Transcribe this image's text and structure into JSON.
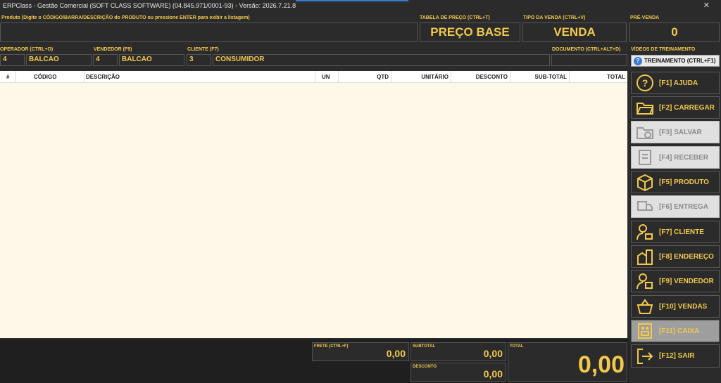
{
  "window": {
    "title": "ERPClass - Gestão Comercial (SOFT CLASS SOFTWARE) (04.845.971/0001-93) - Versão: 2026.7.21.8"
  },
  "product": {
    "label": "Produto (Digite o CÓDIGO/BARRA/DESCRIÇÃO do PRODUTO ou pressione ENTER para exibir a listagem)",
    "value": ""
  },
  "price_table": {
    "label": "TABELA DE PREÇO (CTRL+T)",
    "value": "PREÇO BASE"
  },
  "sale_type": {
    "label": "TIPO DA VENDA (CTRL+V)",
    "value": "VENDA"
  },
  "pre_sale": {
    "label": "PRÉ-VENDA",
    "value": "0"
  },
  "operator": {
    "label": "OPERADOR (CTRL+O)",
    "code": "4",
    "name": "BALCAO"
  },
  "seller": {
    "label": "VENDEDOR (F9)",
    "code": "4",
    "name": "BALCAO"
  },
  "client": {
    "label": "CLIENTE (F7)",
    "code": "3",
    "name": "CONSUMIDOR"
  },
  "document": {
    "label": "DOCUMENTO (CTRL+ALT+D)",
    "value": ""
  },
  "training": {
    "label": "VÍDEOS DE TREINAMENTO",
    "button": "TREINAMENTO (CTRL+F1)"
  },
  "grid": {
    "columns": [
      "#",
      "CÓDIGO",
      "DESCRIÇÃO",
      "UN",
      "QTD",
      "UNITÁRIO",
      "DESCONTO",
      "SUB-TOTAL",
      "TOTAL"
    ],
    "rows": []
  },
  "side_buttons": [
    {
      "label": "[F1] AJUDA",
      "icon": "help-icon",
      "state": "enabled"
    },
    {
      "label": "[F2] CARREGAR",
      "icon": "folder-icon",
      "state": "enabled"
    },
    {
      "label": "[F3] SALVAR",
      "icon": "folder-save-icon",
      "state": "disabled"
    },
    {
      "label": "[F4] RECEBER",
      "icon": "cash-receive-icon",
      "state": "disabled"
    },
    {
      "label": "[F5] PRODUTO",
      "icon": "box-icon",
      "state": "enabled"
    },
    {
      "label": "[F6] ENTREGA",
      "icon": "delivery-icon",
      "state": "disabled"
    },
    {
      "label": "[F7] CLIENTE",
      "icon": "client-icon",
      "state": "enabled"
    },
    {
      "label": "[F8] ENDEREÇO",
      "icon": "address-icon",
      "state": "enabled"
    },
    {
      "label": "[F9] VENDEDOR",
      "icon": "seller-icon",
      "state": "enabled"
    },
    {
      "label": "[F10] VENDAS",
      "icon": "basket-icon",
      "state": "enabled"
    },
    {
      "label": "[F11] CAIXA",
      "icon": "cash-register-icon",
      "state": "active"
    },
    {
      "label": "[F12] SAIR",
      "icon": "exit-icon",
      "state": "enabled"
    }
  ],
  "totals": {
    "frete_label": "FRETE (CTRL+F)",
    "frete": "0,00",
    "subtotal_label": "SUBTOTAL",
    "subtotal": "0,00",
    "desconto_label": "DESCONTO",
    "desconto": "0,00",
    "total_label": "TOTAL",
    "total": "0,00"
  },
  "colors": {
    "accent": "#f2c94c",
    "background": "#2b2b2b",
    "grid": "#fdf8e7"
  }
}
